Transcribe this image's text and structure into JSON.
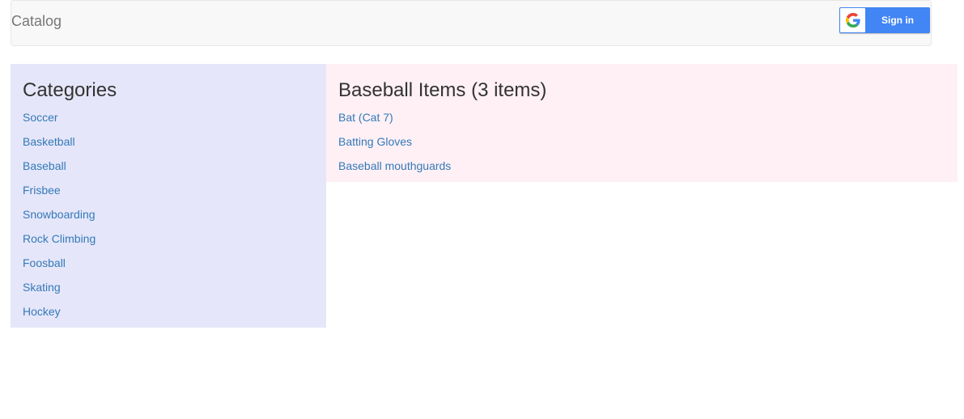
{
  "navbar": {
    "brand": "Catalog",
    "signin": {
      "label": "Sign in",
      "icon": "google-g-icon"
    }
  },
  "categories": {
    "title": "Categories",
    "items": [
      "Soccer",
      "Basketball",
      "Baseball",
      "Frisbee",
      "Snowboarding",
      "Rock Climbing",
      "Foosball",
      "Skating",
      "Hockey"
    ]
  },
  "items_panel": {
    "title": "Baseball Items (3 items)",
    "items": [
      "Bat (Cat 7)",
      "Batting Gloves",
      "Baseball mouthguards"
    ]
  },
  "colors": {
    "link": "#337ab7",
    "categories_bg": "#e6e6fa",
    "items_bg": "#fff0f5",
    "signin_bg": "#4285f4",
    "navbar_bg": "#f8f8f8"
  }
}
